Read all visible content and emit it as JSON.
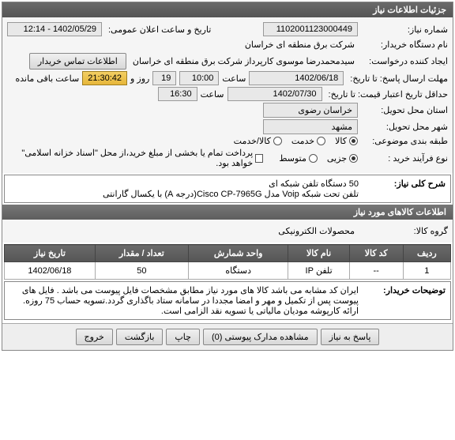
{
  "panel_title": "جزئیات اطلاعات نیاز",
  "row1": {
    "label_num": "شماره نیاز:",
    "num": "1102001123000449",
    "label_pub": "تاریخ و ساعت اعلان عمومی:",
    "pub": "1402/05/29 - 12:14"
  },
  "row2": {
    "label": "نام دستگاه خریدار:",
    "value": "شرکت برق منطقه ای خراسان"
  },
  "row3": {
    "label": "ایجاد کننده درخواست:",
    "value": "سیدمحمدرضا موسوی کارپرداز شرکت برق منطقه ای خراسان",
    "btn": "اطلاعات تماس خریدار"
  },
  "row4": {
    "label": "مهلت ارسال پاسخ: تا تاریخ:",
    "date": "1402/06/18",
    "time_label": "ساعت",
    "time": "10:00",
    "days": "19",
    "days_label": "روز و",
    "countdown": "21:30:42",
    "remain": "ساعت باقی مانده"
  },
  "row5": {
    "label": "حداقل تاریخ اعتبار قیمت: تا تاریخ:",
    "date": "1402/07/30",
    "time_label": "ساعت",
    "time": "16:30"
  },
  "row6": {
    "label": "استان محل تحویل:",
    "value": "خراسان رضوی"
  },
  "row7": {
    "label": "شهر محل تحویل:",
    "value": "مشهد"
  },
  "row8": {
    "label": "طبقه بندی موضوعی:",
    "opt1": "کالا",
    "opt2": "خدمت",
    "opt3": "کالا/خدمت"
  },
  "row9": {
    "label": "نوع فرآیند خرید :",
    "opt1": "جزیی",
    "opt2": "متوسط",
    "chk_label": "پرداخت تمام یا بخشی از مبلغ خرید،از محل \"اسناد خزانه اسلامی\" خواهد بود."
  },
  "desc": {
    "label": "شرح کلی نیاز:",
    "text": "50 دستگاه تلفن شبکه ای\nتلفن تحت شبکه Voip مدل Cisco CP-7965G(درجه A) با یکسال گارانتی"
  },
  "goods_panel_title": "اطلاعات کالاهای مورد نیاز",
  "goods_group": {
    "label": "گروه کالا:",
    "value": "محصولات الکترونیکی"
  },
  "table": {
    "headers": [
      "ردیف",
      "کد کالا",
      "نام کالا",
      "واحد شمارش",
      "تعداد / مقدار",
      "تاریخ نیاز"
    ],
    "rows": [
      {
        "idx": "1",
        "code": "--",
        "name": "تلفن IP",
        "unit": "دستگاه",
        "qty": "50",
        "date": "1402/06/18"
      }
    ]
  },
  "remarks": {
    "label": "توضیحات خریدار:",
    "text": "ایران کد مشابه می باشد کالا های مورد نیاز مطابق مشخصات فایل پیوست می باشد . فایل های پیوست پس از تکمیل و مهر و امضا مجددا در سامانه ستاد باگذاری گردد.تسویه حساب 75 روزه. ارائه کارپوشه مودیان مالیاتی یا تسویه نقد الزامی است."
  },
  "footer": {
    "btn1": "پاسخ به نیاز",
    "btn2": "مشاهده مدارک پیوستی (0)",
    "btn3": "چاپ",
    "btn4": "بازگشت",
    "btn5": "خروج"
  }
}
